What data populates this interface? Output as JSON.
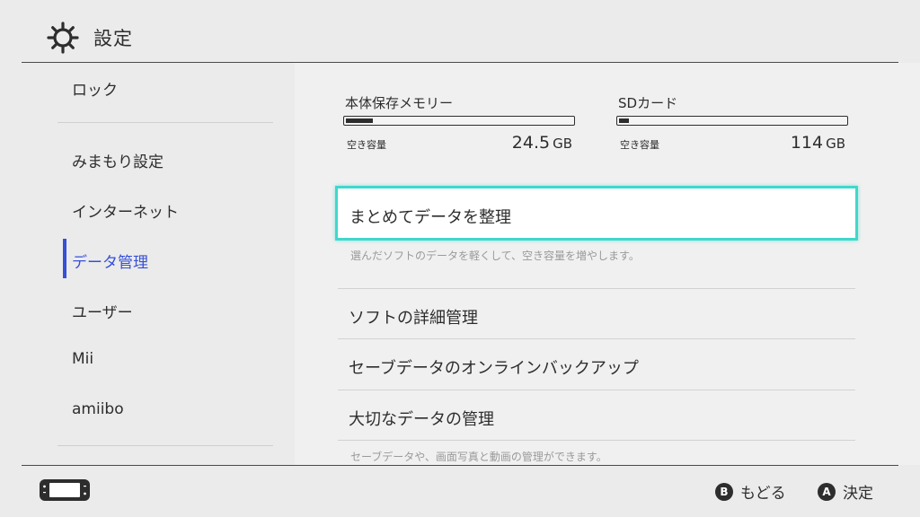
{
  "header": {
    "title": "設定",
    "icon": "gear-icon"
  },
  "sidebar": {
    "items": [
      {
        "label": "ロック"
      },
      {
        "label": "みまもり設定"
      },
      {
        "label": "インターネット"
      },
      {
        "label": "データ管理"
      },
      {
        "label": "ユーザー"
      },
      {
        "label": "Mii"
      },
      {
        "label": "amiibo"
      }
    ],
    "active_label": "データ管理"
  },
  "storage": {
    "system": {
      "label": "本体保存メモリー",
      "free_label": "空き容量",
      "free_value": "24.5",
      "unit": "GB",
      "used_fraction": 0.05
    },
    "sd": {
      "label": "SDカード",
      "free_label": "空き容量",
      "free_value": "114",
      "unit": "GB",
      "used_fraction": 0.03
    }
  },
  "menu": {
    "selected": {
      "label": "まとめてデータを整理",
      "description": "選んだソフトのデータを軽くして、空き容量を増やします。"
    },
    "items": [
      {
        "label": "ソフトの詳細管理"
      },
      {
        "label": "セーブデータのオンラインバックアップ"
      },
      {
        "label": "大切なデータの管理",
        "description": "セーブデータや、画面写真と動画の管理ができます。"
      }
    ]
  },
  "footer": {
    "back": {
      "button": "B",
      "label": "もどる"
    },
    "confirm": {
      "button": "A",
      "label": "決定"
    },
    "console_icon": "handheld-console-icon"
  },
  "colors": {
    "accent": "#3650d8",
    "highlight": "#3fd8cc",
    "text": "#2d2d2d",
    "background": "#ebebeb"
  }
}
